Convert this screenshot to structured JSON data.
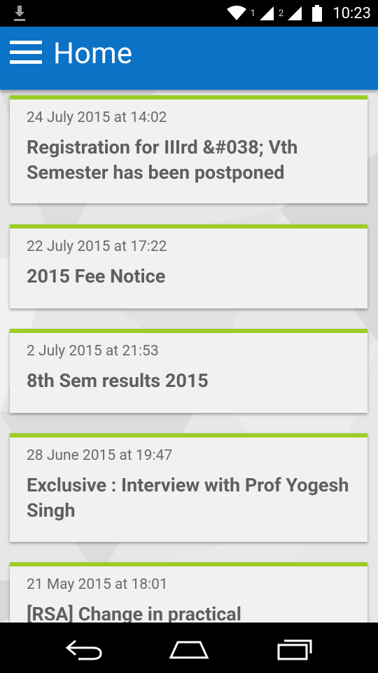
{
  "status_bar": {
    "sim1": "1",
    "sim2": "2",
    "time": "10:23",
    "icons": [
      "download-icon",
      "wifi-icon",
      "signal-icon",
      "signal-icon",
      "battery-icon"
    ]
  },
  "app_bar": {
    "title": "Home",
    "menu_icon": "hamburger-menu-icon",
    "color": "#0b72c6"
  },
  "accent_color": "#9ccc27",
  "notices": [
    {
      "date": "24 July 2015 at 14:02",
      "title": "Registration for IIIrd &#038; Vth Semester has been postponed"
    },
    {
      "date": "22 July 2015 at 17:22",
      "title": "2015 Fee Notice"
    },
    {
      "date": "2 July 2015 at 21:53",
      "title": "8th Sem results 2015"
    },
    {
      "date": "28 June 2015 at 19:47",
      "title": "Exclusive : Interview with Prof Yogesh Singh"
    },
    {
      "date": "21 May 2015 at 18:01",
      "title": "[RSA] Change in practical"
    }
  ],
  "nav_bar": {
    "back_icon": "back-icon",
    "home_icon": "home-icon",
    "recents_icon": "recents-icon"
  }
}
